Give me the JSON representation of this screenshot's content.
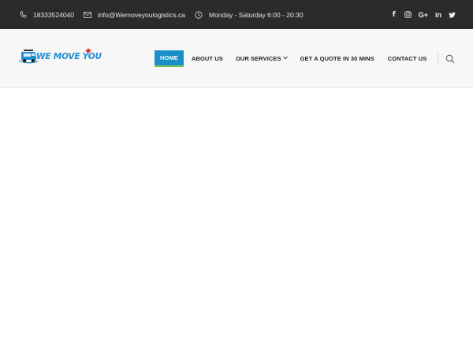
{
  "topbar": {
    "phone": "18333524040",
    "email": "info@Wemoveyoulogistics.ca",
    "hours": "Monday - Saturday 6:00 - 20:30",
    "social": {
      "facebook": "f",
      "googleplus": "G+",
      "linkedin": "in"
    },
    "icons": [
      "phone-icon",
      "mail-icon",
      "clock-icon",
      "facebook-icon",
      "instagram-icon",
      "google-plus-icon",
      "linkedin-icon",
      "twitter-icon"
    ]
  },
  "brand": {
    "name": "WE MOVE YOU",
    "colors": {
      "blue": "#1e8fd6",
      "red": "#e02b2b"
    }
  },
  "nav": {
    "items": [
      {
        "label": "HOME"
      },
      {
        "label": "ABOUT US"
      },
      {
        "label": "OUR SERVICES"
      },
      {
        "label": "GET A QUOTE IN 30 MINS"
      },
      {
        "label": "CONTACT US"
      }
    ],
    "active": "HOME",
    "active_color": "#1a8fc7",
    "active_underline_color": "#6dc15a",
    "dropdown_icon": "chevron-down-icon",
    "search_icon": "search-icon"
  }
}
